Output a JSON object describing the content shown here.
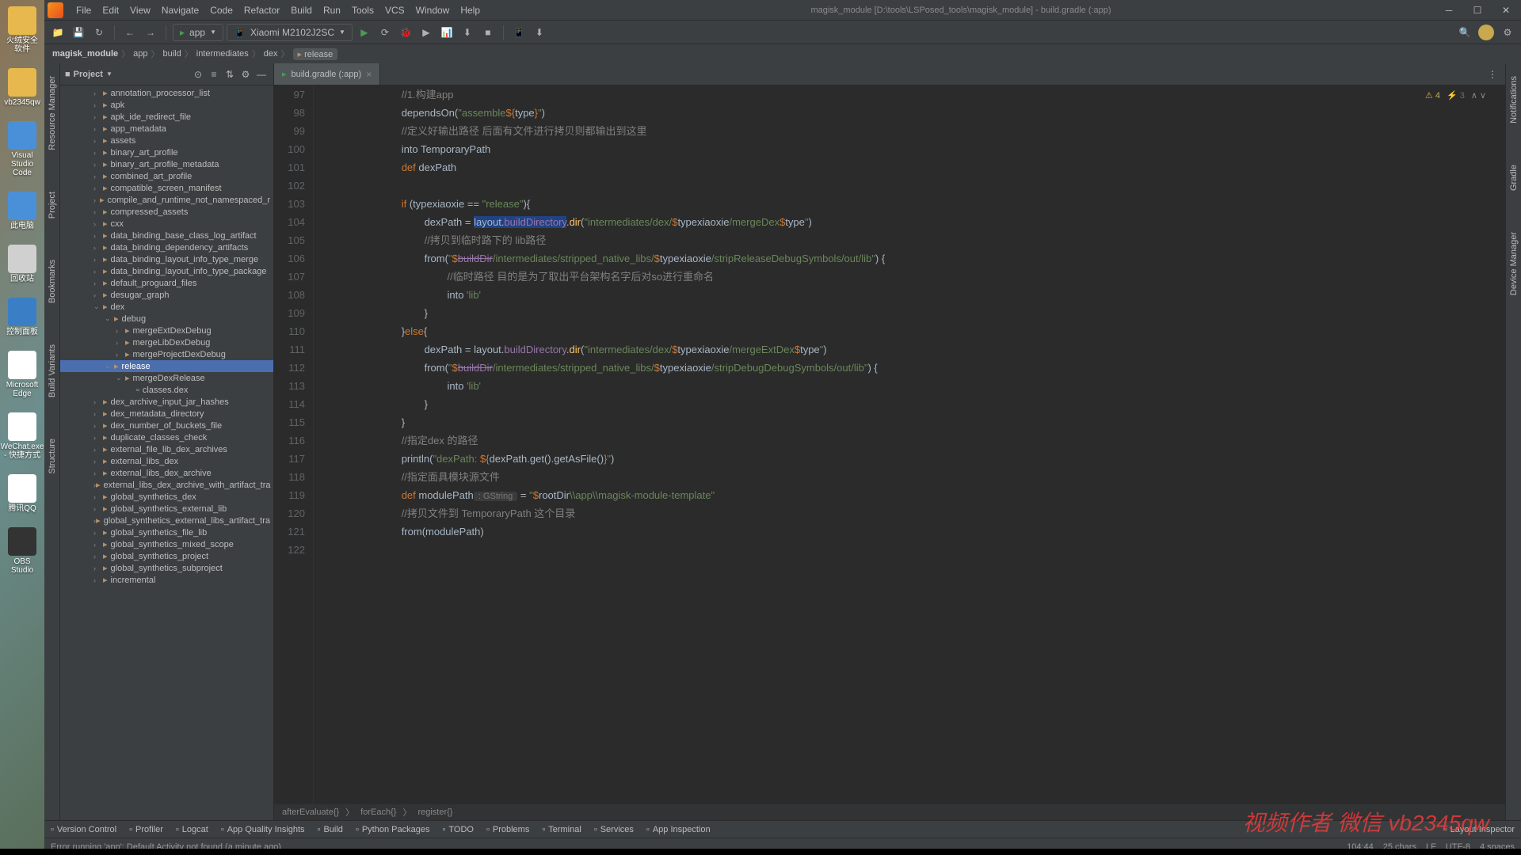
{
  "desktop": {
    "icons": [
      {
        "label": "火绒安全软件",
        "cls": "ico-folder"
      },
      {
        "label": "vb2345qw",
        "cls": "ico-folder"
      },
      {
        "label": "Visual Studio Code",
        "cls": "ico-blue"
      },
      {
        "label": "此电脑",
        "cls": "ico-blue"
      },
      {
        "label": "回收站",
        "cls": "ico-recycle"
      },
      {
        "label": "控制面板",
        "cls": "ico-panel"
      },
      {
        "label": "Microsoft Edge",
        "cls": "ico-edge"
      },
      {
        "label": "WeChat.exe - 快捷方式",
        "cls": "ico-wechat"
      },
      {
        "label": "腾讯QQ",
        "cls": "ico-qq"
      },
      {
        "label": "OBS Studio",
        "cls": "ico-obs"
      }
    ]
  },
  "menu": [
    "File",
    "Edit",
    "View",
    "Navigate",
    "Code",
    "Refactor",
    "Build",
    "Run",
    "Tools",
    "VCS",
    "Window",
    "Help"
  ],
  "title": "magisk_module [D:\\tools\\LSPosed_tools\\magisk_module] - build.gradle (:app)",
  "toolbar": {
    "config1": "app",
    "config2": "Xiaomi M2102J2SC"
  },
  "breadcrumb": [
    "magisk_module",
    "app",
    "build",
    "intermediates",
    "dex",
    "release"
  ],
  "project": {
    "title": "Project",
    "tree": [
      {
        "indent": 3,
        "arrow": "›",
        "type": "folder",
        "name": "annotation_processor_list"
      },
      {
        "indent": 3,
        "arrow": "›",
        "type": "folder",
        "name": "apk"
      },
      {
        "indent": 3,
        "arrow": "›",
        "type": "folder",
        "name": "apk_ide_redirect_file"
      },
      {
        "indent": 3,
        "arrow": "›",
        "type": "folder",
        "name": "app_metadata"
      },
      {
        "indent": 3,
        "arrow": "›",
        "type": "folder",
        "name": "assets"
      },
      {
        "indent": 3,
        "arrow": "›",
        "type": "folder",
        "name": "binary_art_profile"
      },
      {
        "indent": 3,
        "arrow": "›",
        "type": "folder",
        "name": "binary_art_profile_metadata"
      },
      {
        "indent": 3,
        "arrow": "›",
        "type": "folder",
        "name": "combined_art_profile"
      },
      {
        "indent": 3,
        "arrow": "›",
        "type": "folder",
        "name": "compatible_screen_manifest"
      },
      {
        "indent": 3,
        "arrow": "›",
        "type": "folder",
        "name": "compile_and_runtime_not_namespaced_r"
      },
      {
        "indent": 3,
        "arrow": "›",
        "type": "folder",
        "name": "compressed_assets"
      },
      {
        "indent": 3,
        "arrow": "›",
        "type": "folder",
        "name": "cxx"
      },
      {
        "indent": 3,
        "arrow": "›",
        "type": "folder",
        "name": "data_binding_base_class_log_artifact"
      },
      {
        "indent": 3,
        "arrow": "›",
        "type": "folder",
        "name": "data_binding_dependency_artifacts"
      },
      {
        "indent": 3,
        "arrow": "›",
        "type": "folder",
        "name": "data_binding_layout_info_type_merge"
      },
      {
        "indent": 3,
        "arrow": "›",
        "type": "folder",
        "name": "data_binding_layout_info_type_package"
      },
      {
        "indent": 3,
        "arrow": "›",
        "type": "folder",
        "name": "default_proguard_files"
      },
      {
        "indent": 3,
        "arrow": "›",
        "type": "folder",
        "name": "desugar_graph"
      },
      {
        "indent": 3,
        "arrow": "⌄",
        "type": "folder",
        "name": "dex"
      },
      {
        "indent": 4,
        "arrow": "⌄",
        "type": "folder",
        "name": "debug"
      },
      {
        "indent": 5,
        "arrow": "›",
        "type": "folder",
        "name": "mergeExtDexDebug"
      },
      {
        "indent": 5,
        "arrow": "›",
        "type": "folder",
        "name": "mergeLibDexDebug"
      },
      {
        "indent": 5,
        "arrow": "›",
        "type": "folder",
        "name": "mergeProjectDexDebug"
      },
      {
        "indent": 4,
        "arrow": "⌄",
        "type": "folder",
        "name": "release",
        "selected": true
      },
      {
        "indent": 5,
        "arrow": "⌄",
        "type": "folder",
        "name": "mergeDexRelease"
      },
      {
        "indent": 6,
        "arrow": "",
        "type": "file",
        "name": "classes.dex"
      },
      {
        "indent": 3,
        "arrow": "›",
        "type": "folder",
        "name": "dex_archive_input_jar_hashes"
      },
      {
        "indent": 3,
        "arrow": "›",
        "type": "folder",
        "name": "dex_metadata_directory"
      },
      {
        "indent": 3,
        "arrow": "›",
        "type": "folder",
        "name": "dex_number_of_buckets_file"
      },
      {
        "indent": 3,
        "arrow": "›",
        "type": "folder",
        "name": "duplicate_classes_check"
      },
      {
        "indent": 3,
        "arrow": "›",
        "type": "folder",
        "name": "external_file_lib_dex_archives"
      },
      {
        "indent": 3,
        "arrow": "›",
        "type": "folder",
        "name": "external_libs_dex"
      },
      {
        "indent": 3,
        "arrow": "›",
        "type": "folder",
        "name": "external_libs_dex_archive"
      },
      {
        "indent": 3,
        "arrow": "›",
        "type": "folder",
        "name": "external_libs_dex_archive_with_artifact_tra"
      },
      {
        "indent": 3,
        "arrow": "›",
        "type": "folder",
        "name": "global_synthetics_dex"
      },
      {
        "indent": 3,
        "arrow": "›",
        "type": "folder",
        "name": "global_synthetics_external_lib"
      },
      {
        "indent": 3,
        "arrow": "›",
        "type": "folder",
        "name": "global_synthetics_external_libs_artifact_tra"
      },
      {
        "indent": 3,
        "arrow": "›",
        "type": "folder",
        "name": "global_synthetics_file_lib"
      },
      {
        "indent": 3,
        "arrow": "›",
        "type": "folder",
        "name": "global_synthetics_mixed_scope"
      },
      {
        "indent": 3,
        "arrow": "›",
        "type": "folder",
        "name": "global_synthetics_project"
      },
      {
        "indent": 3,
        "arrow": "›",
        "type": "folder",
        "name": "global_synthetics_subproject"
      },
      {
        "indent": 3,
        "arrow": "›",
        "type": "folder",
        "name": "incremental"
      }
    ]
  },
  "editor": {
    "tab": "build.gradle (:app)",
    "inspection": {
      "warnings": "4",
      "weak": "3"
    },
    "lines": [
      97,
      98,
      99,
      100,
      101,
      102,
      103,
      104,
      105,
      106,
      107,
      108,
      109,
      110,
      111,
      112,
      113,
      114,
      115,
      116,
      117,
      118,
      119,
      120,
      121,
      122
    ],
    "code": [
      {
        "ln": 97,
        "pad": 6,
        "html": "<span class='c-comment'>//1.构建app</span>"
      },
      {
        "ln": 98,
        "pad": 6,
        "html": "<span class='c-text'>dependsOn(</span><span class='c-string'>\"assemble</span><span class='c-keyword'>${</span><span class='c-text'>type</span><span class='c-keyword'>}</span><span class='c-string'>\"</span><span class='c-text'>)</span>"
      },
      {
        "ln": 99,
        "pad": 6,
        "html": "<span class='c-comment'>//定义好输出路径 后面有文件进行拷贝则都输出到这里</span>"
      },
      {
        "ln": 100,
        "pad": 6,
        "html": "<span class='c-text'>into TemporaryPath</span>"
      },
      {
        "ln": 101,
        "pad": 6,
        "html": "<span class='c-keyword'>def </span><span class='c-text'>dexPath</span>"
      },
      {
        "ln": 102,
        "pad": 0,
        "html": ""
      },
      {
        "ln": 103,
        "pad": 6,
        "html": "<span class='c-keyword'>if </span><span class='c-text'>(typexiaoxie == </span><span class='c-string'>\"release\"</span><span class='c-text'>){</span>"
      },
      {
        "ln": 104,
        "pad": 8,
        "html": "<span class='c-text'>dexPath = </span><span class='c-highlight'><span class='c-text'>layout.</span><span class='c-field'>buildDirectory</span></span><span class='c-text'>.</span><span class='c-method'>dir</span><span class='c-text'>(</span><span class='c-string'>\"intermediates/dex/</span><span class='c-keyword'>$</span><span class='c-text'>typexiaoxie</span><span class='c-string'>/mergeDex</span><span class='c-keyword'>$</span><span class='c-text'>type</span><span class='c-string'>\"</span><span class='c-text'>)</span>"
      },
      {
        "ln": 105,
        "pad": 8,
        "html": "<span class='c-comment'>//拷贝到临时路下的 lib路径</span>"
      },
      {
        "ln": 106,
        "pad": 8,
        "html": "<span class='c-text'>from(</span><span class='c-string'>\"</span><span class='c-keyword'>$</span><span class='c-field c-strike'>buildDir</span><span class='c-string'>/intermediates/stripped_native_libs/</span><span class='c-keyword'>$</span><span class='c-text'>typexiaoxie</span><span class='c-string'>/stripReleaseDebugSymbols/out/lib\"</span><span class='c-text'>) {</span>"
      },
      {
        "ln": 107,
        "pad": 10,
        "html": "<span class='c-comment'>//临时路径 目的是为了取出平台架构名字后对so进行重命名</span>"
      },
      {
        "ln": 108,
        "pad": 10,
        "html": "<span class='c-text'>into </span><span class='c-string'>'lib'</span>"
      },
      {
        "ln": 109,
        "pad": 8,
        "html": "<span class='c-text'>}</span>"
      },
      {
        "ln": 110,
        "pad": 6,
        "html": "<span class='c-text'>}</span><span class='c-keyword'>else</span><span class='c-text'>{</span>"
      },
      {
        "ln": 111,
        "pad": 8,
        "html": "<span class='c-text'>dexPath = layout.</span><span class='c-field'>buildDirectory</span><span class='c-text'>.</span><span class='c-method'>dir</span><span class='c-text'>(</span><span class='c-string'>\"intermediates/dex/</span><span class='c-keyword'>$</span><span class='c-text'>typexiaoxie</span><span class='c-string'>/mergeExtDex</span><span class='c-keyword'>$</span><span class='c-text'>type</span><span class='c-string'>\"</span><span class='c-text'>)</span>"
      },
      {
        "ln": 112,
        "pad": 8,
        "html": "<span class='c-text'>from(</span><span class='c-string'>\"</span><span class='c-keyword'>$</span><span class='c-field c-strike'>buildDir</span><span class='c-string'>/intermediates/stripped_native_libs/</span><span class='c-keyword'>$</span><span class='c-text'>typexiaoxie</span><span class='c-string'>/stripDebugDebugSymbols/out/lib\"</span><span class='c-text'>) {</span>"
      },
      {
        "ln": 113,
        "pad": 10,
        "html": "<span class='c-text'>into </span><span class='c-string'>'lib'</span>"
      },
      {
        "ln": 114,
        "pad": 8,
        "html": "<span class='c-text'>}</span>"
      },
      {
        "ln": 115,
        "pad": 6,
        "html": "<span class='c-text'>}</span>"
      },
      {
        "ln": 116,
        "pad": 6,
        "html": "<span class='c-comment'>//指定dex 的路径</span>"
      },
      {
        "ln": 117,
        "pad": 6,
        "html": "<span class='c-text'>println(</span><span class='c-string'>\"dexPath: </span><span class='c-keyword'>${</span><span class='c-text'>dexPath.get().getAsFile()</span><span class='c-keyword'>}</span><span class='c-string'>\"</span><span class='c-text'>)</span>"
      },
      {
        "ln": 118,
        "pad": 6,
        "html": "<span class='c-comment'>//指定面具模块源文件</span>"
      },
      {
        "ln": 119,
        "pad": 6,
        "html": "<span class='c-keyword'>def </span><span class='c-text'>modulePath</span><span class='c-hint'> : GString </span><span class='c-text'> = </span><span class='c-string'>\"</span><span class='c-keyword'>$</span><span class='c-text'>rootDir</span><span class='c-string'>\\\\app\\\\magisk-module-template\"</span>"
      },
      {
        "ln": 120,
        "pad": 6,
        "html": "<span class='c-comment'>//拷贝文件到 TemporaryPath 这个目录</span>"
      },
      {
        "ln": 121,
        "pad": 6,
        "html": "<span class='c-text'>from(modulePath)</span>"
      },
      {
        "ln": 122,
        "pad": 0,
        "html": ""
      }
    ],
    "code_breadcrumb": [
      "afterEvaluate{}",
      "forEach{}",
      "register{}"
    ]
  },
  "bottom_tools": [
    "Version Control",
    "Profiler",
    "Logcat",
    "App Quality Insights",
    "Build",
    "Python Packages",
    "TODO",
    "Problems",
    "Terminal",
    "Services",
    "App Inspection"
  ],
  "bottom_right": "Layout Inspector",
  "status": {
    "left": "Error running 'app': Default Activity not found (a minute ago)",
    "right": [
      "104:44",
      "25 chars",
      "LF",
      "UTF-8",
      "4 spaces"
    ]
  },
  "watermark": "视频作者  微信 vb2345qw"
}
